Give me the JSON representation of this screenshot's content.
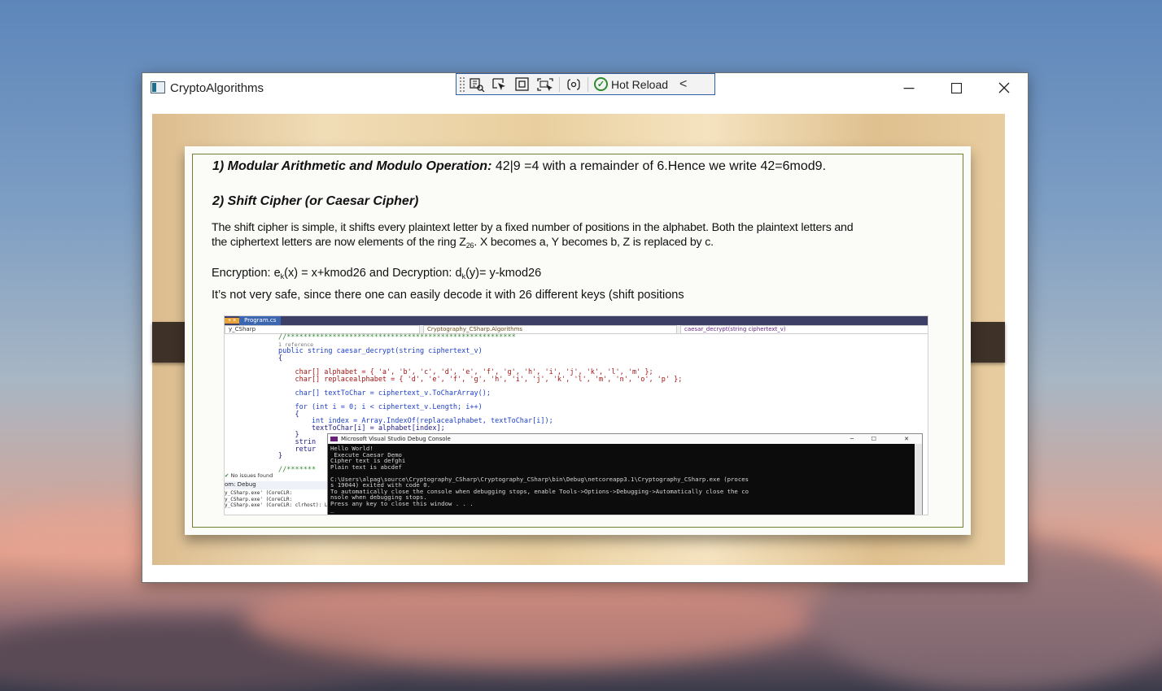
{
  "window": {
    "title": "CryptoAlgorithms"
  },
  "toolbar": {
    "icons": [
      "select-element-icon",
      "select-element-icon",
      "layout-adorners-icon",
      "track-focused-element-icon",
      "binding-failures-icon"
    ],
    "hot_reload_label": "Hot Reload",
    "collapse_glyph": "<"
  },
  "controls": {
    "minimize_glyph": "─",
    "maximize_glyph": "☐",
    "close_glyph": "✕"
  },
  "slide": {
    "s1_heading": "1)   Modular Arithmetic and Modulo Operation:",
    "s1_body": " 42|9 =4 with a remainder  of 6.Hence we write 42=6mod9.",
    "s2_heading": "2)  Shift Cipher (or Caesar Cipher)",
    "p1_line1": "The shift cipher is simple, it shifts every plaintext letter by a fixed number of positions in the alphabet.   Both the plaintext letters and",
    "p1_line2a": "the ciphertext letters are now elements of the ring Z",
    "p1_line2_sub": "26",
    "p1_line2b": ". X becomes a, Y becomes b, Z is replaced by c.",
    "enc_a": "Encryption: e",
    "enc_sub1": "k",
    "enc_b": "(x) = x+kmod26 and  Decryption:  d",
    "enc_sub2": "k",
    "enc_c": "(y)= y-kmod26",
    "safety": "It’s not very safe, since there one can easily decode it with  26 different keys (shift positions"
  },
  "screenshot": {
    "tab_left": "+ ×",
    "tab": "Program.cs",
    "nav_project": "y_CSharp",
    "nav_class": "Cryptography_CSharp.Algorithms",
    "nav_member": "caesar_decrypt(string ciphertext_v)",
    "code": [
      "//*******************************************************",
      "1 reference",
      "public string caesar_decrypt(string ciphertext_v)",
      "{",
      "",
      "    char[] alphabet = { 'a', 'b', 'c', 'd', 'e', 'f', 'g', 'h', 'i', 'j', 'k', 'l', 'm' };",
      "    char[] replacealphabet = { 'd', 'e', 'f', 'g', 'h', 'i', 'j', 'k', 'l', 'm', 'n', 'o', 'p' };",
      "",
      "    char[] textToChar = ciphertext_v.ToCharArray();",
      "",
      "    for (int i = 0; i < ciphertext_v.Length; i++)",
      "    {",
      "        int index = Array.IndexOf(replacealphabet, textToChar[i]);",
      "        textToChar[i] = alphabet[index];",
      "    }",
      "    strin",
      "    retur",
      "}",
      "",
      "//*******"
    ],
    "status": "No issues found",
    "output_label": "om:  Debug",
    "output_lines": [
      "y_CSharp.exe' (CoreCLR:",
      "y_CSharp.exe' (CoreCLR:",
      "y_CSharp.exe' (CoreCLR: clrhost): Loaded 'C:\\Program Files\\dotnet\\shared\\Microsoft.NETCore.App\\3.1.11\\System.Threading.dll'. Skipped loading symbols. Module is"
    ],
    "console_title": "Microsoft Visual Studio Debug Console",
    "console_lines": [
      "Hello World!",
      " Execute Caesar Demo",
      "Cipher text is defghi",
      "Plain text is abcdef",
      "",
      "C:\\Users\\alpag\\source\\Cryptography_CSharp\\Cryptography_CSharp\\bin\\Debug\\netcoreapp3.1\\Cryptography_CSharp.exe (proces",
      "s 19044) exited with code 0.",
      "To automatically close the console when debugging stops, enable Tools->Options->Debugging->Automatically close the co",
      "nsole when debugging stops.",
      "Press any key to close this window . . .",
      "_"
    ]
  }
}
